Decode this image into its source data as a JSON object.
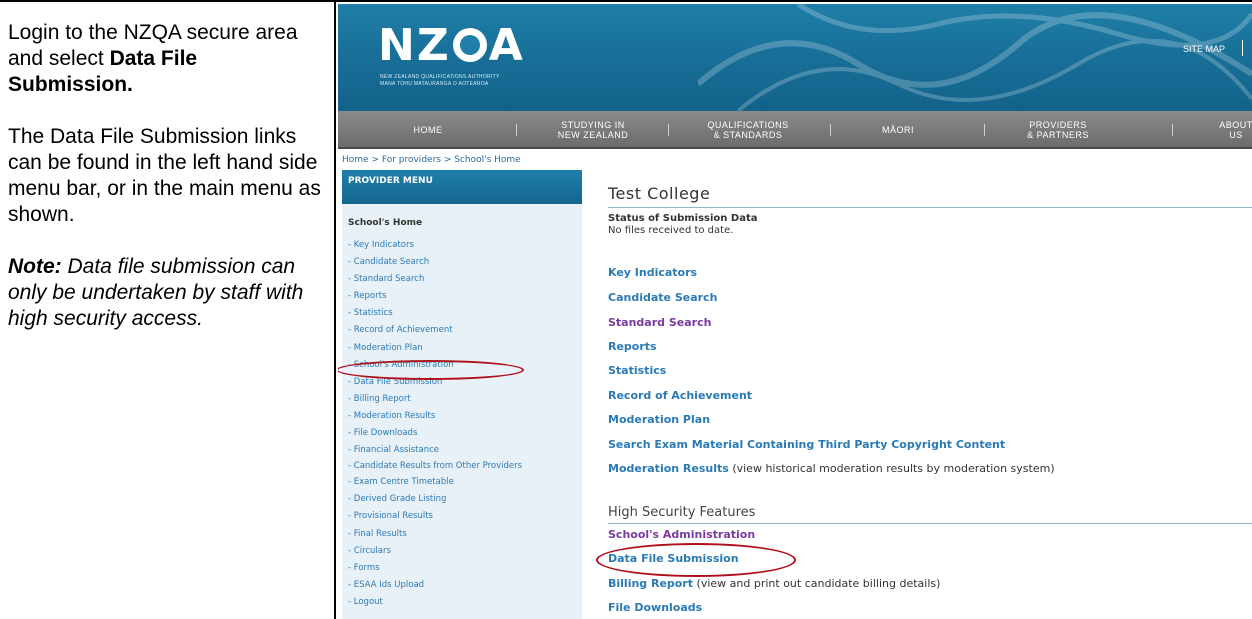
{
  "instructions": {
    "para1_text": "Login to the NZQA secure area and select ",
    "para1_bold": "Data File Submission.",
    "para2": "The Data File Submission links can be found in the left hand side menu bar, or in the main menu as shown.",
    "note_label": "Note:",
    "note_text": " Data file submission can only be undertaken by staff with high security access."
  },
  "site": {
    "logo_left": "NZ",
    "logo_right": "A",
    "logo_sub_line1": "NEW ZEALAND QUALIFICATIONS AUTHORITY",
    "logo_sub_line2": "MANA TOHU MATAURANGA O AOTEAROA",
    "site_map": "SITE MAP",
    "brand_color": "#1f7fa8"
  },
  "nav": {
    "items": [
      {
        "label": "HOME"
      },
      {
        "label": "STUDYING IN\nNEW ZEALAND"
      },
      {
        "label": "QUALIFICATIONS\n& STANDARDS"
      },
      {
        "label": "MĀORI"
      },
      {
        "label": "PROVIDERS\n& PARTNERS"
      },
      {
        "label": "ABOUT\nUS"
      }
    ]
  },
  "breadcrumb": "Home > For providers > School's Home",
  "provider_menu": {
    "heading": "PROVIDER MENU",
    "title": "School's Home",
    "items": [
      "- Key Indicators",
      "- Candidate Search",
      "- Standard Search",
      "- Reports",
      "- Statistics",
      "- Record of Achievement",
      "- Moderation Plan",
      "- School's Administration",
      "- Data File Submission",
      "- Billing Report",
      "- Moderation Results",
      "- File Downloads",
      "- Financial Assistance",
      "- Candidate Results from Other Providers",
      "- Exam Centre Timetable",
      "- Derived Grade Listing",
      "- Provisional Results",
      "- Final Results",
      "- Circulars",
      "- Forms",
      "- ESAA Ids Upload",
      "- Logout"
    ]
  },
  "main": {
    "school_name": "Test College",
    "status_heading": "Status of Submission Data",
    "status_value": "No files received to date.",
    "links": [
      {
        "label": "Key Indicators",
        "desc": ""
      },
      {
        "label": "Candidate Search",
        "desc": ""
      },
      {
        "label": "Standard Search",
        "desc": ""
      },
      {
        "label": "Reports",
        "desc": ""
      },
      {
        "label": "Statistics",
        "desc": ""
      },
      {
        "label": "Record of Achievement",
        "desc": ""
      },
      {
        "label": "Moderation Plan",
        "desc": ""
      },
      {
        "label": "Search Exam Material Containing Third Party Copyright Content",
        "desc": ""
      },
      {
        "label": "Moderation Results",
        "desc": " (view historical moderation results by moderation system)"
      }
    ],
    "high_security_heading": "High Security Features",
    "high_security_links": [
      {
        "label": "School's Administration",
        "desc": ""
      },
      {
        "label": "Data File Submission",
        "desc": ""
      },
      {
        "label": "Billing Report",
        "desc": " (view and print out candidate billing details)"
      },
      {
        "label": "File Downloads",
        "desc": ""
      }
    ]
  },
  "highlight_color": "#b0101a"
}
